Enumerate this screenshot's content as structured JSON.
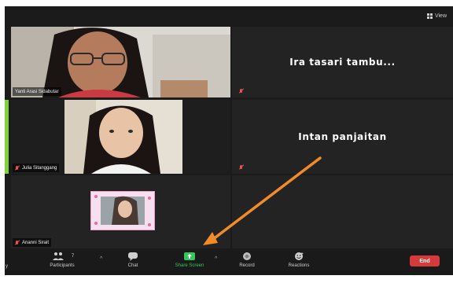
{
  "window": {
    "view_label": "View"
  },
  "participants": [
    {
      "name": "Yanti Arasi Sidabutar",
      "muted": true,
      "video": "on"
    },
    {
      "name": "Ira tasari tambu...",
      "muted": true,
      "video": "off"
    },
    {
      "name": "Julia Sitanggang",
      "muted": true,
      "video": "on",
      "active_speaker": true
    },
    {
      "name": "Intan panjaitan",
      "muted": true,
      "video": "off"
    },
    {
      "name": "Ananni Sirait",
      "muted": true,
      "video": "thumbnail"
    }
  ],
  "toolbar": {
    "left_label": "y",
    "participants_label": "Participants",
    "participants_count": "7",
    "chat_label": "Chat",
    "share_label": "Share Screen",
    "record_label": "Record",
    "reactions_label": "Reactions",
    "end_label": "End"
  },
  "colors": {
    "share_accent": "#32c85a",
    "end_button": "#d63a3a",
    "active_speaker": "#7fd23a",
    "annotation_arrow": "#f28c28"
  },
  "icons": [
    "view-grid-icon",
    "mute-mic-icon",
    "participants-icon",
    "chat-icon",
    "share-screen-icon",
    "record-icon",
    "reactions-icon",
    "chevron-up-icon"
  ]
}
